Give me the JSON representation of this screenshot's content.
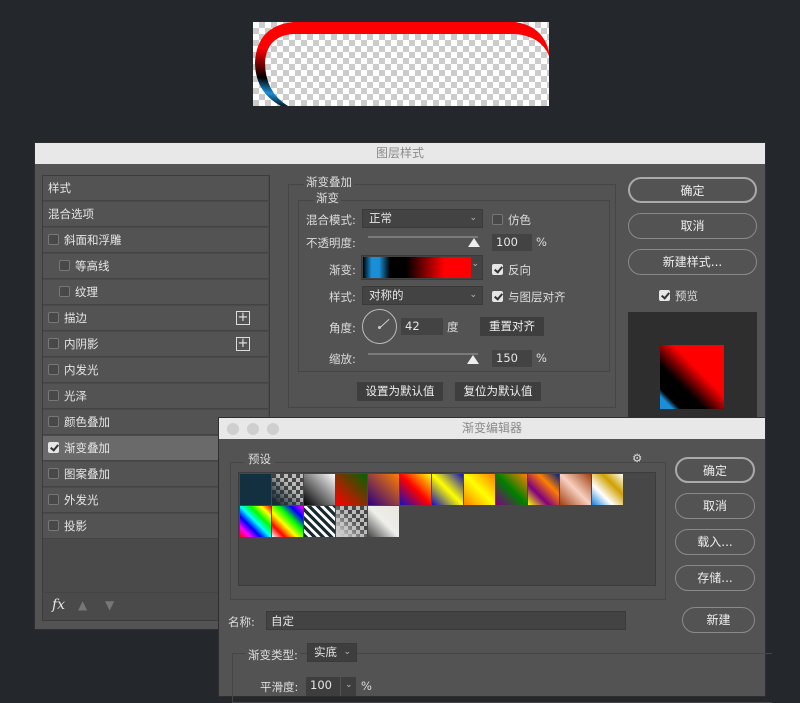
{
  "canvas_preview": {
    "arc_colors": [
      "#ff0000",
      "#000000",
      "#1a8fd8"
    ]
  },
  "layer_style": {
    "title": "图层样式",
    "sidebar": [
      {
        "label": "样式",
        "checkbox": null
      },
      {
        "label": "混合选项",
        "checkbox": null
      },
      {
        "label": "斜面和浮雕",
        "checkbox": false
      },
      {
        "label": "等高线",
        "checkbox": false,
        "indent": true
      },
      {
        "label": "纹理",
        "checkbox": false,
        "indent": true
      },
      {
        "label": "描边",
        "checkbox": false,
        "plus": true
      },
      {
        "label": "内阴影",
        "checkbox": false,
        "plus": true
      },
      {
        "label": "内发光",
        "checkbox": false
      },
      {
        "label": "光泽",
        "checkbox": false
      },
      {
        "label": "颜色叠加",
        "checkbox": false
      },
      {
        "label": "渐变叠加",
        "checkbox": true,
        "selected": true
      },
      {
        "label": "图案叠加",
        "checkbox": false
      },
      {
        "label": "外发光",
        "checkbox": false
      },
      {
        "label": "投影",
        "checkbox": false
      }
    ],
    "footer": {
      "fx": "fx"
    },
    "section_title": "渐变叠加",
    "subsection_title": "渐变",
    "blend_mode_label": "混合模式:",
    "blend_mode": "正常",
    "dither_label": "仿色",
    "dither": false,
    "opacity_label": "不透明度:",
    "opacity": "100",
    "opacity_unit": "%",
    "gradient_label": "渐变:",
    "reverse_label": "反向",
    "reverse": true,
    "style_label": "样式:",
    "style": "对称的",
    "align_label": "与图层对齐",
    "align": true,
    "angle_label": "角度:",
    "angle": "42",
    "angle_unit": "度",
    "reset_align": "重置对齐",
    "scale_label": "缩放:",
    "scale": "150",
    "scale_unit": "%",
    "set_default": "设置为默认值",
    "reset_default": "复位为默认值",
    "ok": "确定",
    "cancel": "取消",
    "new_style": "新建样式...",
    "preview_label": "预览",
    "preview": true
  },
  "gradient_editor": {
    "title": "渐变编辑器",
    "presets_label": "预设",
    "presets": [
      [
        "#12303f",
        "#12303f"
      ],
      [
        "#1a2a33",
        "#cccccc"
      ],
      [
        "#000000",
        "#ffffff"
      ],
      [
        "#ff0000",
        "#006400"
      ],
      [
        "#2a0080",
        "#ff7f00"
      ],
      [
        "#1010c0",
        "#ff0000",
        "#ffff00"
      ],
      [
        "#1010c0",
        "#ffff00",
        "#1010c0"
      ],
      [
        "#ff7f00",
        "#ffff00",
        "#ff7f00"
      ],
      [
        "#800080",
        "#008000",
        "#ff7f00"
      ],
      [
        "#ffff00",
        "#800080",
        "#ff7f00",
        "#002080"
      ],
      [
        "#a04010",
        "#f8d0c0",
        "#a04010"
      ],
      [
        "#1080e0",
        "#ffffff",
        "#d0a000",
        "#ffffff"
      ],
      [
        "#ff0000",
        "#ff00ff",
        "#0000ff",
        "#00ffff",
        "#00ff00",
        "#ffff00",
        "#ff0000"
      ],
      [
        "#ffffff",
        "#ff0000",
        "#ffff00",
        "#00ff00",
        "#0000ff",
        "#ff00ff"
      ],
      [
        "#1a2a33",
        "#ffffff",
        "#1a2a33",
        "#ffffff"
      ],
      [
        "#cccccc",
        "#eeeeee"
      ],
      [
        "#444444",
        "#eeeeea",
        "#e8e6de"
      ]
    ],
    "ok": "确定",
    "cancel": "取消",
    "load": "载入...",
    "save": "存储...",
    "name_label": "名称:",
    "name": "自定",
    "new": "新建",
    "type_label": "渐变类型:",
    "type": "实底",
    "smooth_label": "平滑度:",
    "smooth": "100",
    "smooth_unit": "%"
  }
}
